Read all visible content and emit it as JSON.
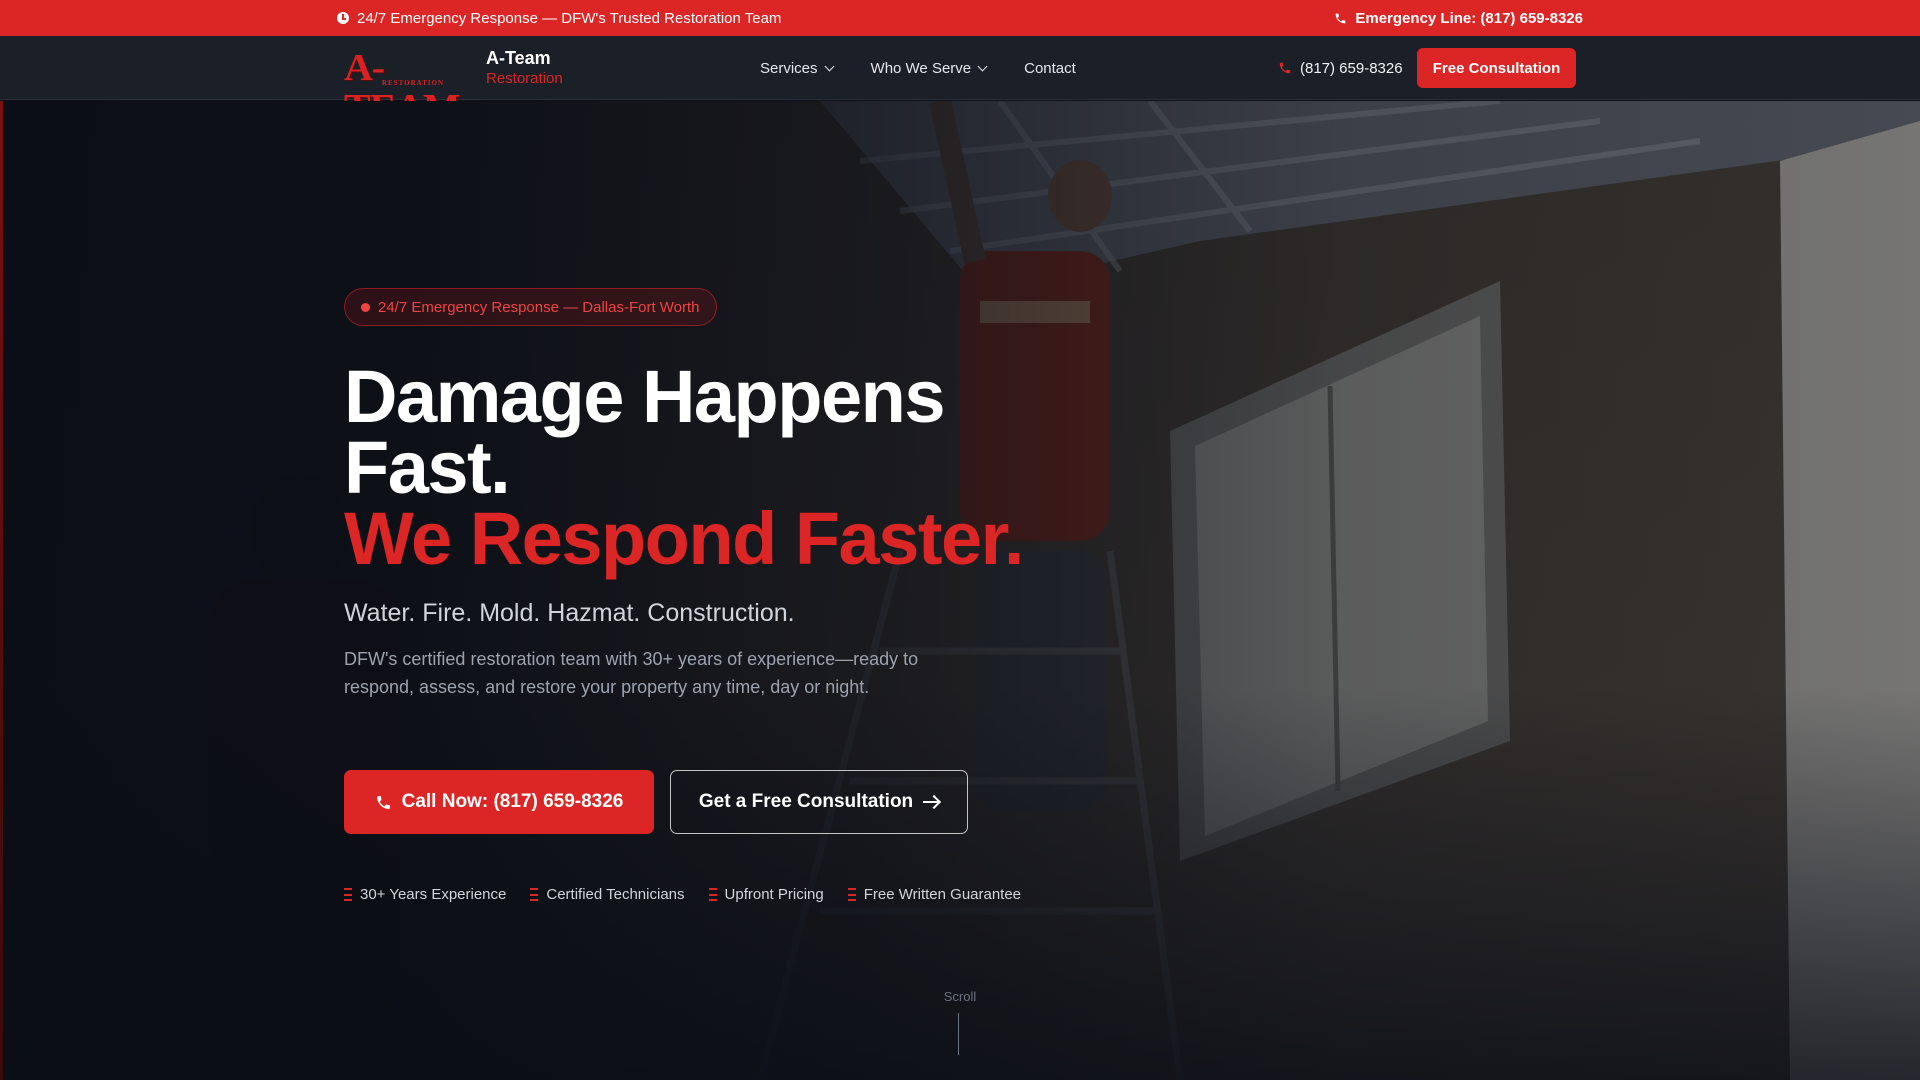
{
  "topbar": {
    "left_text": "24/7 Emergency Response — DFW's Trusted Restoration Team",
    "left_icon": "clock-icon",
    "right_text": "Emergency Line: (817) 659-8326",
    "right_icon": "phone-icon",
    "background": "#dc2626"
  },
  "brand": {
    "logo_text": "A-TEAM",
    "logo_subtext": "RESTORATION",
    "name": "A-Team",
    "tagline": "Restoration"
  },
  "nav": {
    "links": [
      {
        "label": "Services",
        "has_dropdown": true
      },
      {
        "label": "Who We Serve",
        "has_dropdown": true
      },
      {
        "label": "Contact",
        "has_dropdown": false
      }
    ],
    "phone": "(817) 659-8326",
    "cta_label": "Free Consultation"
  },
  "hero": {
    "badge": "24/7 Emergency Response — Dallas-Fort Worth",
    "headline_line1": "Damage Happens",
    "headline_line2": "Fast.",
    "headline_accent": "We Respond Faster.",
    "services": "Water. Fire. Mold. Hazmat. Construction.",
    "description": "DFW's certified restoration team with 30+ years of experience—ready to respond, assess, and restore your property any time, day or night.",
    "primary_button": "Call Now: (817) 659-8326",
    "secondary_button": "Get a Free Consultation",
    "trust_items": [
      "30+ Years Experience",
      "Certified Technicians",
      "Upfront Pricing",
      "Free Written Guarantee"
    ],
    "scroll_label": "Scroll"
  },
  "colors": {
    "accent": "#dc2626",
    "navbar": "#1b1f27",
    "hero_overlay": "#0a0d16"
  }
}
